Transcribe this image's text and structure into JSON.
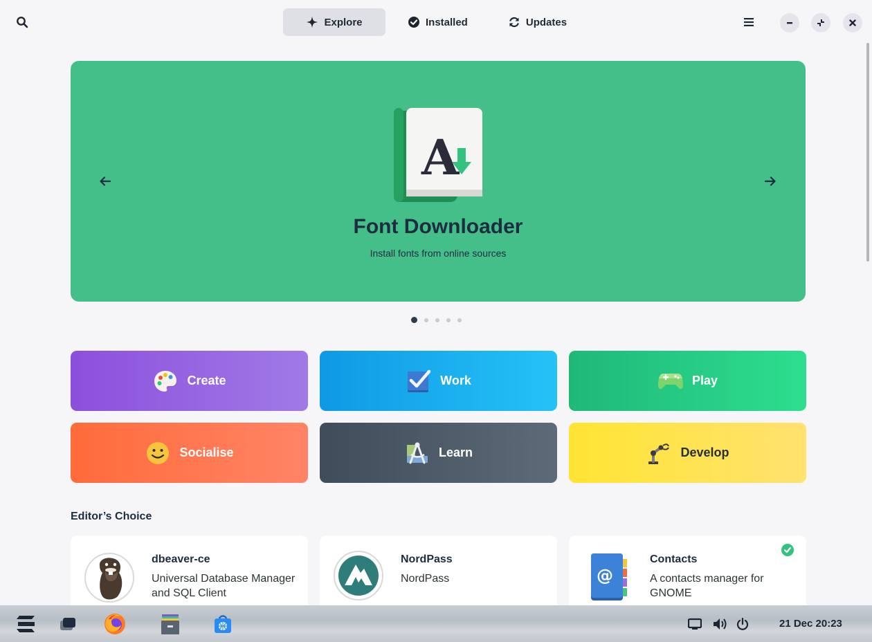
{
  "header": {
    "tabs": [
      {
        "label": "Explore",
        "icon": "explore-star-icon",
        "active": true
      },
      {
        "label": "Installed",
        "icon": "check-circle-icon",
        "active": false
      },
      {
        "label": "Updates",
        "icon": "refresh-icon",
        "active": false
      }
    ]
  },
  "banner": {
    "title": "Font Downloader",
    "subtitle": "Install fonts from online sources",
    "color": "#44bf89",
    "page_count": 5,
    "current_page": 1
  },
  "categories": [
    {
      "label": "Create",
      "icon": "palette-icon"
    },
    {
      "label": "Work",
      "icon": "checkbox-icon"
    },
    {
      "label": "Play",
      "icon": "gamepad-icon"
    },
    {
      "label": "Socialise",
      "icon": "smiley-icon"
    },
    {
      "label": "Learn",
      "icon": "compass-icon"
    },
    {
      "label": "Develop",
      "icon": "robot-arm-icon"
    }
  ],
  "editors_choice": {
    "title": "Editor’s Choice",
    "apps": [
      {
        "name": "dbeaver-ce",
        "description": "Universal Database Manager and SQL Client",
        "icon": "beaver-icon",
        "installed": false
      },
      {
        "name": "NordPass",
        "description": "NordPass",
        "icon": "nordpass-icon",
        "installed": false
      },
      {
        "name": "Contacts",
        "description": "A contacts manager for GNOME",
        "icon": "contacts-book-icon",
        "installed": true
      }
    ]
  },
  "taskbar": {
    "clock": "21 Dec  20:23"
  }
}
